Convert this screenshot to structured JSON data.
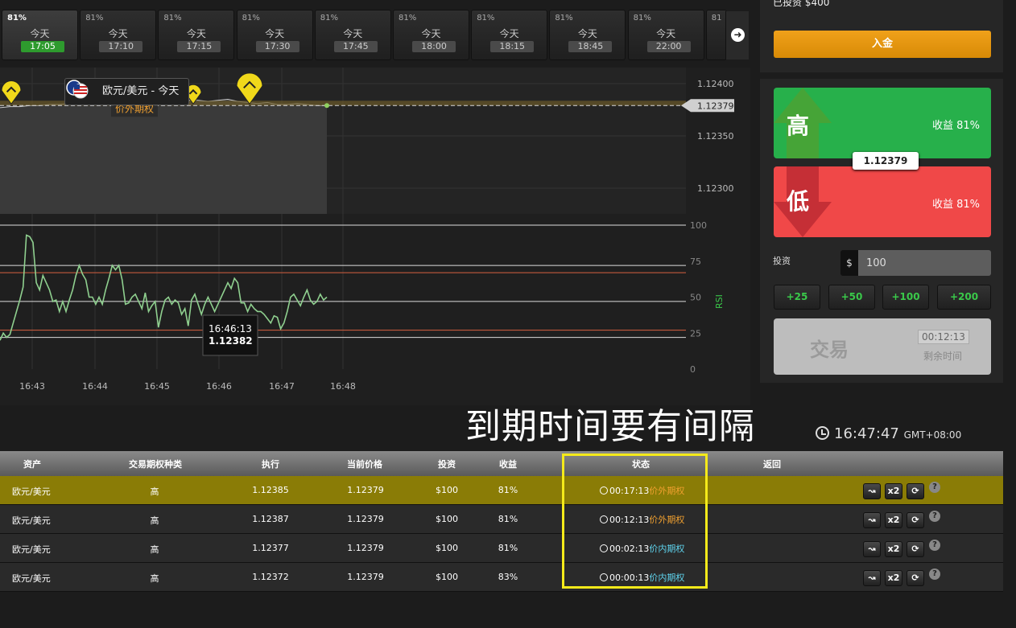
{
  "tabs": [
    {
      "payout": "81%",
      "day": "今天",
      "time": "17:05",
      "active": true
    },
    {
      "payout": "81%",
      "day": "今天",
      "time": "17:10"
    },
    {
      "payout": "81%",
      "day": "今天",
      "time": "17:15"
    },
    {
      "payout": "81%",
      "day": "今天",
      "time": "17:30"
    },
    {
      "payout": "81%",
      "day": "今天",
      "time": "17:45"
    },
    {
      "payout": "81%",
      "day": "今天",
      "time": "18:00"
    },
    {
      "payout": "81%",
      "day": "今天",
      "time": "18:15"
    },
    {
      "payout": "81%",
      "day": "今天",
      "time": "18:45"
    },
    {
      "payout": "81%",
      "day": "今天",
      "time": "22:00"
    },
    {
      "payout": "81"
    }
  ],
  "chart": {
    "asset_label": "欧元/美元 - 今天",
    "current_price_tag": "1.12379",
    "marker_label": "价外期权",
    "price_ticks": [
      "1.12400",
      "1.12350",
      "1.12300"
    ],
    "osc_ticks": [
      "100",
      "75",
      "50",
      "25",
      "0"
    ],
    "osc_side_label": "RSI",
    "time_ticks": [
      "16:43",
      "16:44",
      "16:45",
      "16:46",
      "16:47",
      "16:48"
    ],
    "tooltip_time": "16:46:13",
    "tooltip_value": "1.12382"
  },
  "chart_data": {
    "type": "line",
    "price_series": [
      1.12377,
      1.12378,
      1.12378,
      1.12379,
      1.12379,
      1.1238,
      1.1238,
      1.12381,
      1.1238,
      1.12381,
      1.12382,
      1.12381,
      1.1238,
      1.12381,
      1.12382,
      1.12382,
      1.12384,
      1.12385,
      1.12385,
      1.12384,
      1.12384,
      1.12383,
      1.12384,
      1.12385,
      1.12383,
      1.12382,
      1.12381,
      1.12382,
      1.1238,
      1.1238,
      1.12381,
      1.1238,
      1.12379,
      1.12379
    ],
    "osc_series": [
      20,
      25,
      22,
      24,
      32,
      40,
      48,
      57,
      93,
      92,
      88,
      60,
      55,
      65,
      60,
      55,
      47,
      48,
      40,
      47,
      40,
      48,
      55,
      65,
      72,
      66,
      62,
      50,
      50,
      45,
      50,
      45,
      55,
      63,
      72,
      69,
      72,
      62,
      45,
      46,
      50,
      52,
      47,
      42,
      53,
      40,
      44,
      47,
      29,
      40,
      48,
      50,
      45,
      48,
      46,
      38,
      42,
      30,
      48,
      52,
      45,
      38,
      45,
      50,
      45,
      40,
      45,
      50,
      55,
      60,
      56,
      63,
      60,
      46,
      46,
      40,
      45,
      42,
      40,
      40,
      38,
      35,
      32,
      37,
      36,
      28,
      32,
      40,
      50,
      52,
      48,
      44,
      50,
      55,
      48,
      45,
      47,
      52,
      48,
      50
    ],
    "price_ylim": [
      1.1228,
      1.1242
    ],
    "osc_ylim": [
      0,
      100
    ],
    "osc_lines": [
      75,
      50,
      25
    ]
  },
  "account": {
    "invested_text": "已投资 $400",
    "deposit_label": "入金"
  },
  "trade_panel": {
    "high_label": "高",
    "high_payout": "收益 81%",
    "low_label": "低",
    "low_payout": "收益 81%",
    "price": "1.12379",
    "invest_label": "投资",
    "currency": "$",
    "amount": "100",
    "quick_amounts": [
      "+25",
      "+50",
      "+100",
      "+200"
    ],
    "trade_label": "交易",
    "countdown": "00:12:13",
    "remaining_label": "剩余时间"
  },
  "annotation": "到期时间要有间隔",
  "clock": {
    "time": "16:47:47",
    "tz": "GMT+08:00"
  },
  "table": {
    "headers": [
      "资产",
      "交易期权种类",
      "执行",
      "当前价格",
      "投资",
      "收益",
      "状态",
      "返回"
    ],
    "rows": [
      {
        "asset": "欧元/美元",
        "type": "高",
        "strike": "1.12385",
        "current": "1.12379",
        "invest": "$100",
        "payout": "81%",
        "time": "00:17:13",
        "status": "价外期权",
        "status_kind": "out",
        "highlight": true
      },
      {
        "asset": "欧元/美元",
        "type": "高",
        "strike": "1.12387",
        "current": "1.12379",
        "invest": "$100",
        "payout": "81%",
        "time": "00:12:13",
        "status": "价外期权",
        "status_kind": "out"
      },
      {
        "asset": "欧元/美元",
        "type": "高",
        "strike": "1.12377",
        "current": "1.12379",
        "invest": "$100",
        "payout": "81%",
        "time": "00:02:13",
        "status": "价内期权",
        "status_kind": "in"
      },
      {
        "asset": "欧元/美元",
        "type": "高",
        "strike": "1.12372",
        "current": "1.12379",
        "invest": "$100",
        "payout": "83%",
        "time": "00:00:13",
        "status": "价内期权",
        "status_kind": "in"
      }
    ],
    "actions": [
      "sell-icon",
      "double-up-icon",
      "rollover-icon"
    ],
    "double_label": "x2",
    "help_label": "?"
  }
}
